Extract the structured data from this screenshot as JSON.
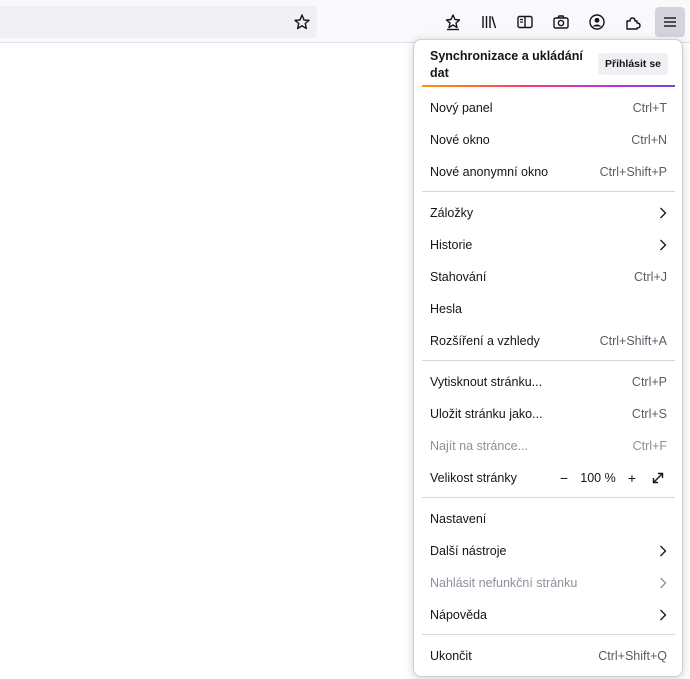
{
  "toolbar": {
    "icons": [
      "bookmark-star-icon",
      "save-to-pocket-icon",
      "library-icon",
      "sidebar-icon",
      "screenshot-icon",
      "account-icon",
      "extensions-icon",
      "app-menu-icon"
    ]
  },
  "menu": {
    "sync_title": "Synchronizace a ukládání dat",
    "sign_in": "Přihlásit se",
    "new_tab": {
      "label": "Nový panel",
      "shortcut": "Ctrl+T"
    },
    "new_window": {
      "label": "Nové okno",
      "shortcut": "Ctrl+N"
    },
    "private_window": {
      "label": "Nové anonymní okno",
      "shortcut": "Ctrl+Shift+P"
    },
    "bookmarks": {
      "label": "Záložky"
    },
    "history": {
      "label": "Historie"
    },
    "downloads": {
      "label": "Stahování",
      "shortcut": "Ctrl+J"
    },
    "passwords": {
      "label": "Hesla"
    },
    "addons": {
      "label": "Rozšíření a vzhledy",
      "shortcut": "Ctrl+Shift+A"
    },
    "print": {
      "label": "Vytisknout stránku...",
      "shortcut": "Ctrl+P"
    },
    "save_page": {
      "label": "Uložit stránku jako...",
      "shortcut": "Ctrl+S"
    },
    "find": {
      "label": "Najít na stránce...",
      "shortcut": "Ctrl+F"
    },
    "zoom": {
      "label": "Velikost stránky",
      "minus": "−",
      "value": "100 %",
      "plus": "+"
    },
    "settings": {
      "label": "Nastavení"
    },
    "more_tools": {
      "label": "Další nástroje"
    },
    "report": {
      "label": "Nahlásit nefunkční stránku"
    },
    "help": {
      "label": "Nápověda"
    },
    "quit": {
      "label": "Ukončit",
      "shortcut": "Ctrl+Shift+Q"
    }
  },
  "colors": {
    "accent_gradient": [
      "#ff9500",
      "#ff3b6b",
      "#b833e1",
      "#7542e5"
    ],
    "disabled_text": "#8f8f9d"
  }
}
